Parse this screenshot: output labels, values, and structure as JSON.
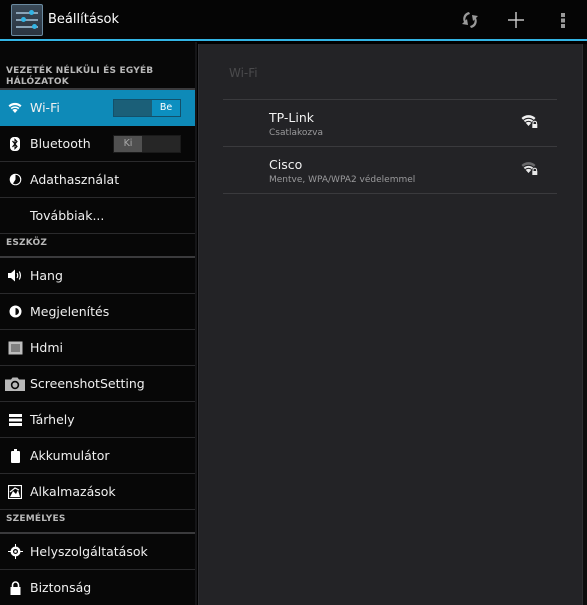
{
  "action_bar": {
    "title": "Beállítások",
    "app_icon": "settings-sliders-icon",
    "buttons": [
      {
        "name": "scan",
        "icon": "refresh-icon"
      },
      {
        "name": "add-network",
        "icon": "plus-icon"
      },
      {
        "name": "overflow-menu",
        "icon": "more-vertical-icon"
      }
    ],
    "accent_color": "#33b5e5"
  },
  "sidebar": {
    "sections": [
      {
        "header": "VEZETÉK NÉLKÜLI ÉS EGYÉB HÁLÓZATOK"
      },
      {
        "header": "ESZKÖZ"
      },
      {
        "header": "SZEMÉLYES"
      }
    ],
    "items": [
      {
        "label": "Wi-Fi",
        "icon": "wifi-icon",
        "selected": true,
        "toggle": "Be",
        "toggle_on": true
      },
      {
        "label": "Bluetooth",
        "icon": "bluetooth-icon",
        "toggle": "Ki",
        "toggle_on": false
      },
      {
        "label": "Adathasználat",
        "icon": "data-usage-icon"
      },
      {
        "label": "Továbbiak...",
        "icon": ""
      },
      {
        "label": "Hang",
        "icon": "volume-icon"
      },
      {
        "label": "Megjelenítés",
        "icon": "brightness-icon"
      },
      {
        "label": "Hdmi",
        "icon": "hdmi-icon"
      },
      {
        "label": "ScreenshotSetting",
        "icon": "camera-icon"
      },
      {
        "label": "Tárhely",
        "icon": "storage-icon"
      },
      {
        "label": "Akkumulátor",
        "icon": "battery-icon"
      },
      {
        "label": "Alkalmazások",
        "icon": "apps-icon"
      },
      {
        "label": "Helyszolgáltatások",
        "icon": "location-icon"
      },
      {
        "label": "Biztonság",
        "icon": "lock-icon"
      }
    ],
    "selected_color": "#0e8ab8"
  },
  "panel": {
    "title": "Wi-Fi",
    "networks": [
      {
        "name": "TP-Link",
        "status": "Csatlakozva",
        "icon": "wifi-secured-full-icon"
      },
      {
        "name": "Cisco",
        "status": "Mentve, WPA/WPA2 védelemmel",
        "icon": "wifi-secured-dim-icon"
      }
    ]
  }
}
